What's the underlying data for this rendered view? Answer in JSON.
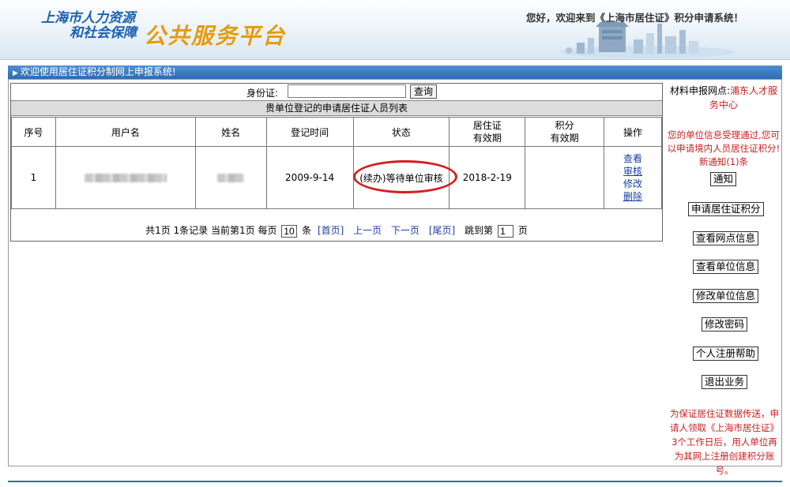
{
  "header": {
    "logo_line1": "上海市人力资源",
    "logo_line2": "和社会保障",
    "logo_big": "公共服务平台",
    "welcome": "您好，欢迎来到《上海市居住证》积分申请系统！"
  },
  "banner": {
    "text": "欢迎使用居住证积分制网上申报系统!"
  },
  "search": {
    "label": "身份证:",
    "value": "",
    "button": "查询"
  },
  "list": {
    "title": "贵单位登记的申请居住证人员列表",
    "columns": [
      "序号",
      "用户名",
      "姓名",
      "登记时间",
      "状态",
      "居住证有效期",
      "积分有效期",
      "操作"
    ],
    "col_residence_l1": "居住证",
    "col_residence_l2": "有效期",
    "col_points_l1": "积分",
    "col_points_l2": "有效期",
    "rows": [
      {
        "index": "1",
        "username": "",
        "name": "",
        "reg_date": "2009-9-14",
        "status": "(续办)等待单位审核",
        "residence_valid": "2018-2-19",
        "points_valid": "",
        "ops": [
          "查看",
          "审核",
          "修改",
          "删除"
        ]
      }
    ]
  },
  "pager": {
    "total": "共1页 1条记录 当前第1页 每页",
    "per_page": "10",
    "unit": "条",
    "first": "[首页]",
    "prev": "上一页",
    "next": "下一页",
    "last": "[尾页]",
    "jump_label": "跳到第",
    "jump_value": "1",
    "page_unit": "页"
  },
  "side": {
    "addr_label": "材料申报网点:",
    "addr_value": "浦东人才服务中心",
    "notice_text": "您的单位信息受理通过,您可以申请境内人员居住证积分!",
    "new_notice": "新通知(1)条",
    "notice_button": "通知",
    "buttons": [
      "申请居住证积分",
      "查看网点信息",
      "查看单位信息",
      "修改单位信息",
      "修改密码",
      "个人注册帮助",
      "退出业务"
    ],
    "bottom_note": "为保证居住证数据传送，申请人领取《上海市居住证》3个工作日后，用人单位再为其网上注册创建积分账号。"
  },
  "colors": {
    "accent_blue": "#2e6cb3",
    "logo_blue": "#1b61b0",
    "logo_orange": "#e09b17",
    "alert_red": "#c91f1f",
    "circle_red": "#d41f1f"
  }
}
